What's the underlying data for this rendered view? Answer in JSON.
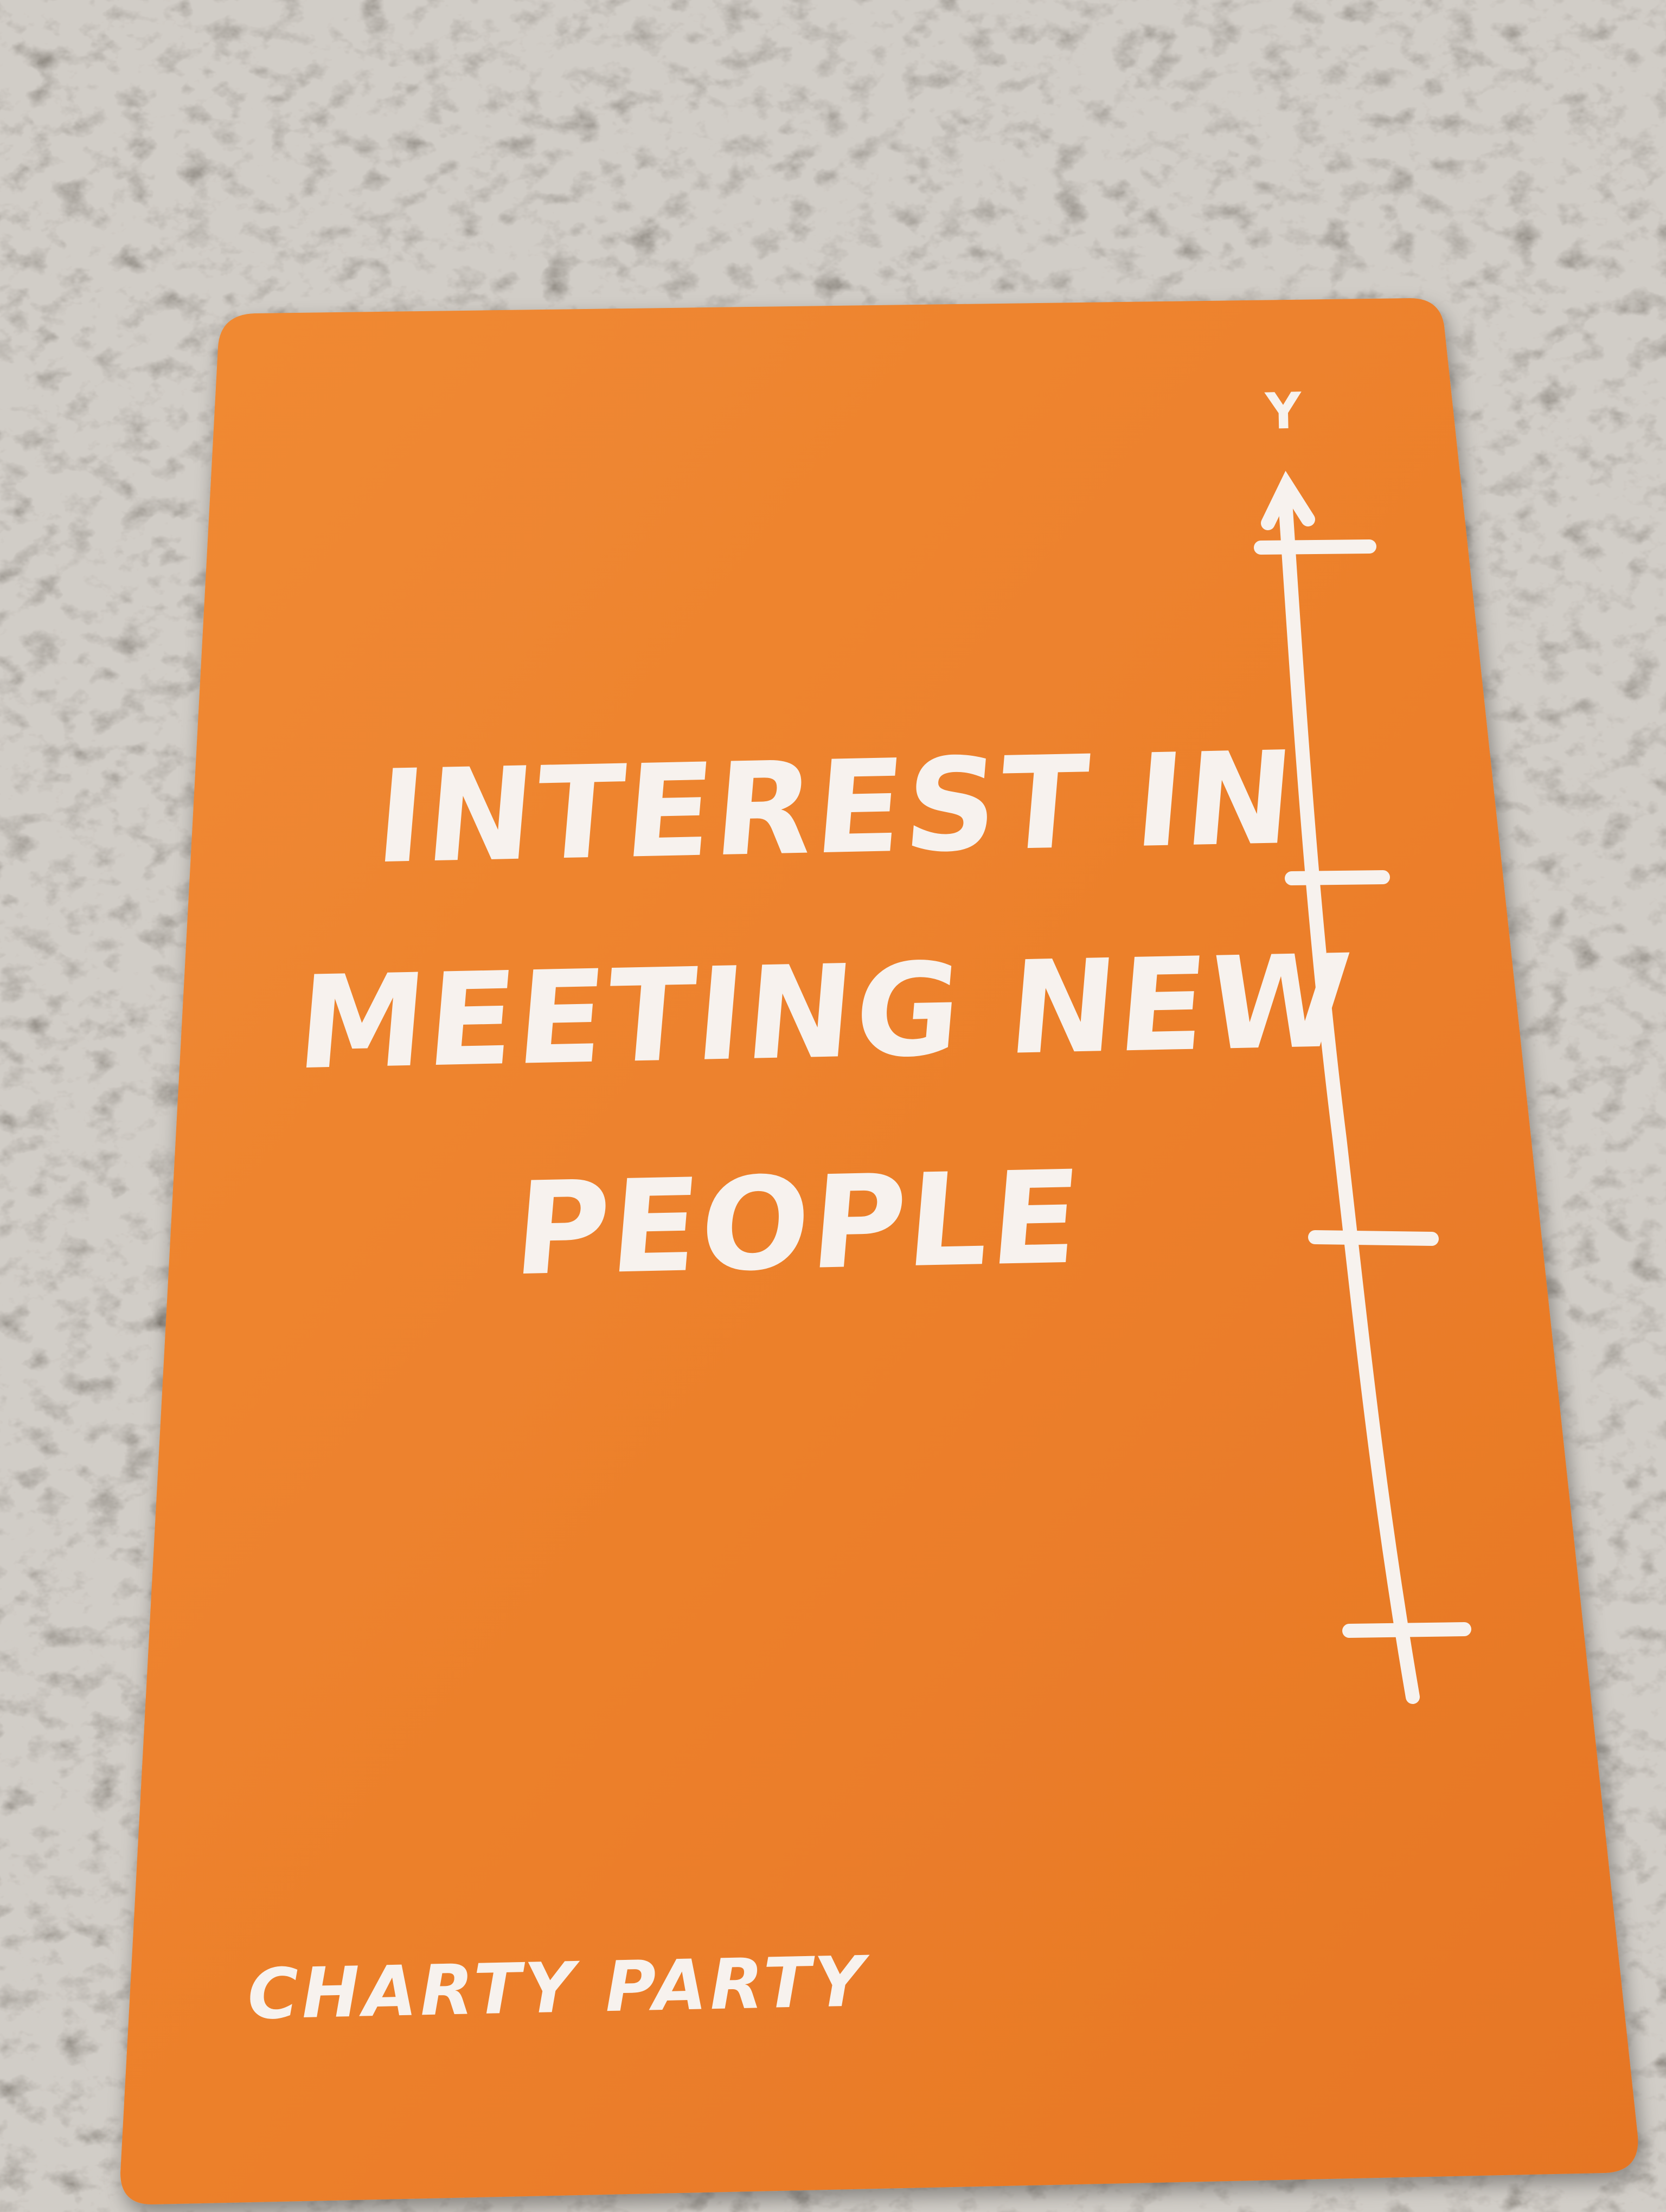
{
  "card": {
    "title_lines": [
      "INTEREST IN",
      "MEETING NEW",
      "PEOPLE"
    ],
    "brand": "CHARTY PARTY",
    "axis_label": "Y",
    "color": "#ec7f2b",
    "text_color": "#f7f2ee"
  },
  "background": {
    "description_color": "#a59f96"
  }
}
